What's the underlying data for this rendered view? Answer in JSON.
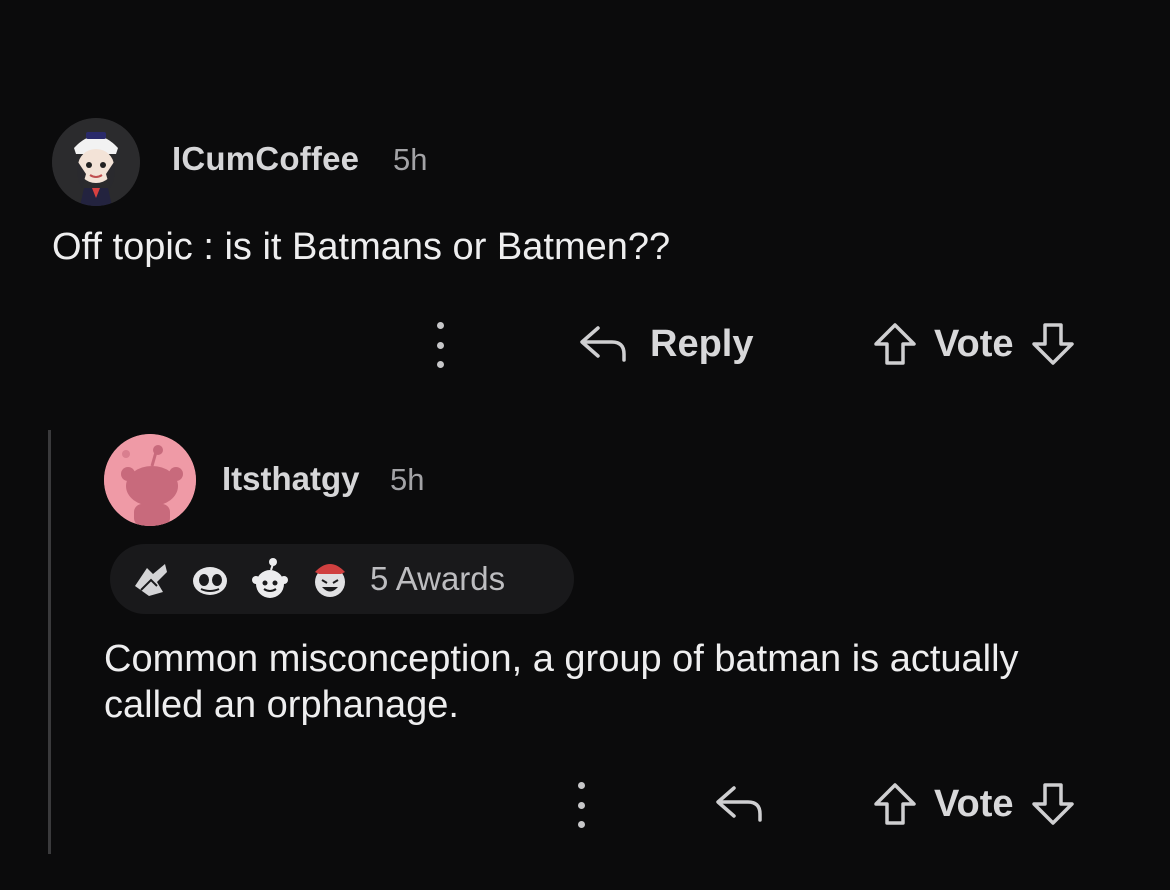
{
  "comments": [
    {
      "username": "ICumCoffee",
      "time": "5h",
      "body": "Off topic : is it Batmans or Batmen??",
      "reply_label": "Reply",
      "vote_label": "Vote"
    },
    {
      "username": "Itsthatgy",
      "time": "5h",
      "awards_label": "5 Awards",
      "body": "Common misconception, a group of batman is actually called an orphanage.",
      "vote_label": "Vote"
    }
  ],
  "icons": {
    "more": "more-options-icon",
    "reply": "reply-arrow-icon",
    "upvote": "upvote-arrow-icon",
    "downvote": "downvote-arrow-icon"
  },
  "colors": {
    "background": "#0b0b0c",
    "text": "#eeeeef",
    "muted": "#a3a3a6",
    "avatar2_bg": "#ef9aa6"
  }
}
